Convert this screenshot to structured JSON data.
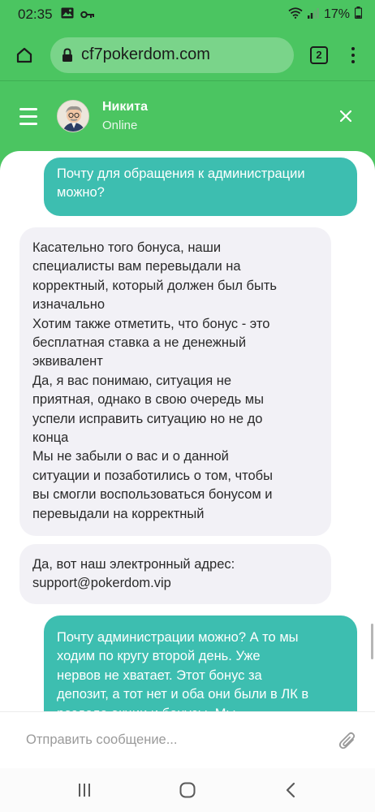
{
  "status_bar": {
    "time": "02:35",
    "battery": "17%"
  },
  "browser": {
    "url": "cf7pokerdom.com",
    "tab_count": "2"
  },
  "chat": {
    "agent_name": "Никита",
    "agent_status": "Online",
    "composer_placeholder": "Отправить сообщение...",
    "messages": [
      {
        "from": "user",
        "lines": [
          "Почту для обращения к администрации",
          "можно?"
        ]
      },
      {
        "from": "agent",
        "lines": [
          "Касательно того бонуса, наши",
          "специалисты вам перевыдали на",
          "корректный, который должен был быть",
          "изначально",
          "Хотим также отметить, что бонус - это",
          "бесплатная ставка а не денежный",
          "эквивалент",
          "Да, я вас понимаю, ситуация не",
          "приятная, однако в свою очередь мы",
          "успели исправить ситуацию но не до",
          "конца",
          "Мы не забыли о вас и о данной",
          "ситуации и позаботились о том, чтобы",
          "вы смогли воспользоваться бонусом и",
          "перевыдали на корректный"
        ]
      },
      {
        "from": "agent",
        "lines": [
          "Да, вот наш электронный адрес:",
          "support@pokerdom.vip"
        ]
      },
      {
        "from": "user",
        "lines": [
          "Почту администрации можно? А то мы",
          "ходим по кругу второй день. Уже",
          "нервов не хватает. Этот бонус за",
          "депозит, а тот нет и оба они были в ЛК в",
          "разделе акции и бонусы. Мы"
        ]
      }
    ]
  },
  "colors": {
    "brand_green": "#4bc561",
    "user_bubble": "#3dbeb0",
    "agent_bubble": "#f2f1f6"
  }
}
